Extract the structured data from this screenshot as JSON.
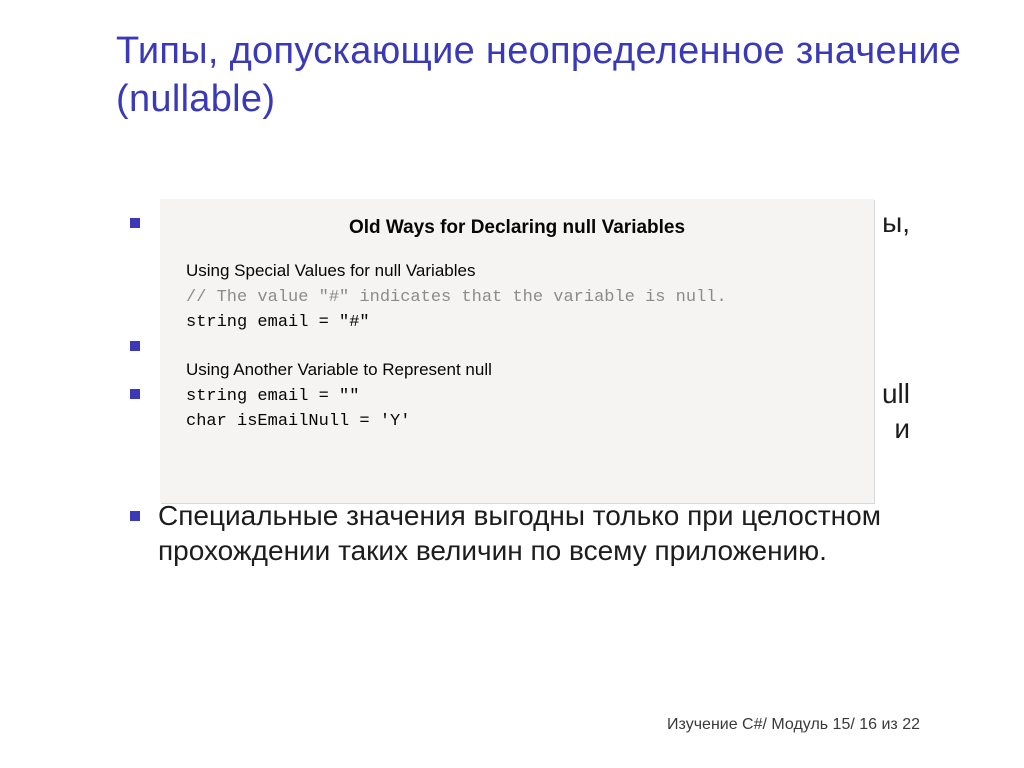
{
  "title": "Типы, допускающие неопределенное значение (nullable)",
  "bullets": {
    "b1_tail": "ы,",
    "b2": " ",
    "b3_tail": "ull и",
    "b4": "Специальные значения выгодны только при целостном прохождении таких величин по всему приложению."
  },
  "code": {
    "heading": "Old Ways for Declaring null Variables",
    "section1_title": "Using Special Values for null Variables",
    "section1_comment": "// The value \"#\" indicates that the variable is null.",
    "section1_code": "string email = \"#\"",
    "section2_title": "Using Another Variable to Represent null",
    "section2_code1": "string email = \"\"",
    "section2_code2": "char isEmailNull = 'Y'"
  },
  "footer": "Изучение C#/ Модуль 15/ 16 из 22"
}
